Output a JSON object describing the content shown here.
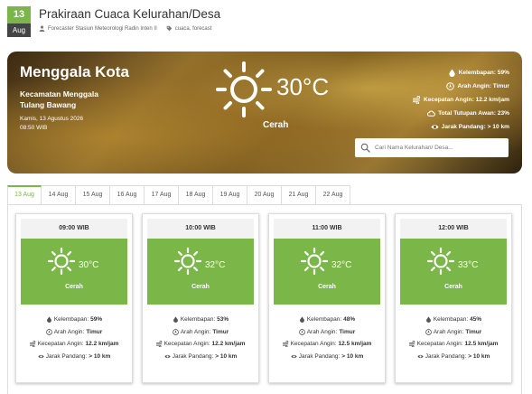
{
  "post": {
    "date_day": "13",
    "date_month": "Aug",
    "title": "Prakiraan Cuaca Kelurahan/Desa",
    "author": "Forecaster Stasiun Meteorologi Radin Inten II",
    "tags": "cuaca, forecast"
  },
  "current": {
    "city": "Menggala Kota",
    "district_line1": "Kecamatan Menggala",
    "district_line2": "Tulang Bawang",
    "date": "Kamis, 13 Agustus 2026",
    "time": "08:50 WIB",
    "temperature": "30°C",
    "condition": "Cerah",
    "humidity": "Kelembapan: 59%",
    "wind_dir": "Arah Angin: Timur",
    "wind_speed": "Kecepatan Angin: 12.2 km/jam",
    "cloud_cover": "Total Tutupan Awan: 23%",
    "visibility": "Jarak Pandang: > 10 km"
  },
  "search": {
    "placeholder": "Cari Nama Kelurahan/ Desa..."
  },
  "tabs": [
    {
      "label": "13 Aug",
      "active": true
    },
    {
      "label": "14 Aug"
    },
    {
      "label": "15 Aug"
    },
    {
      "label": "16 Aug"
    },
    {
      "label": "17 Aug"
    },
    {
      "label": "18 Aug"
    },
    {
      "label": "19 Aug"
    },
    {
      "label": "20 Aug"
    },
    {
      "label": "21 Aug"
    },
    {
      "label": "22 Aug"
    }
  ],
  "forecast": [
    {
      "hour": "09:00 WIB",
      "temp": "30°C",
      "cond": "Cerah",
      "hum_label": "Kelembapan:",
      "hum": "59%",
      "dir_label": "Arah Angin:",
      "dir": "Timur",
      "spd_label": "Kecepatan Angin:",
      "spd": "12.2 km/jam",
      "vis_label": "Jarak Pandang:",
      "vis": "> 10 km"
    },
    {
      "hour": "10:00 WIB",
      "temp": "32°C",
      "cond": "Cerah",
      "hum_label": "Kelembapan:",
      "hum": "53%",
      "dir_label": "Arah Angin:",
      "dir": "Timur",
      "spd_label": "Kecepatan Angin:",
      "spd": "12.2 km/jam",
      "vis_label": "Jarak Pandang:",
      "vis": "> 10 km"
    },
    {
      "hour": "11:00 WIB",
      "temp": "32°C",
      "cond": "Cerah",
      "hum_label": "Kelembapan:",
      "hum": "48%",
      "dir_label": "Arah Angin:",
      "dir": "Timur",
      "spd_label": "Kecepatan Angin:",
      "spd": "12.5 km/jam",
      "vis_label": "Jarak Pandang:",
      "vis": "> 10 km"
    },
    {
      "hour": "12:00 WIB",
      "temp": "33°C",
      "cond": "Cerah",
      "hum_label": "Kelembapan:",
      "hum": "45%",
      "dir_label": "Arah Angin:",
      "dir": "Timur",
      "spd_label": "Kecepatan Angin:",
      "spd": "12.5 km/jam",
      "vis_label": "Jarak Pandang:",
      "vis": "> 10 km"
    }
  ],
  "colors": {
    "accent_green": "#7ab648",
    "badge_dark": "#444444"
  },
  "icons": [
    "user-icon",
    "tag-icon",
    "sun-icon",
    "humidity-drop-icon",
    "compass-icon",
    "wind-icon",
    "cloud-icon",
    "eye-icon",
    "search-icon"
  ]
}
